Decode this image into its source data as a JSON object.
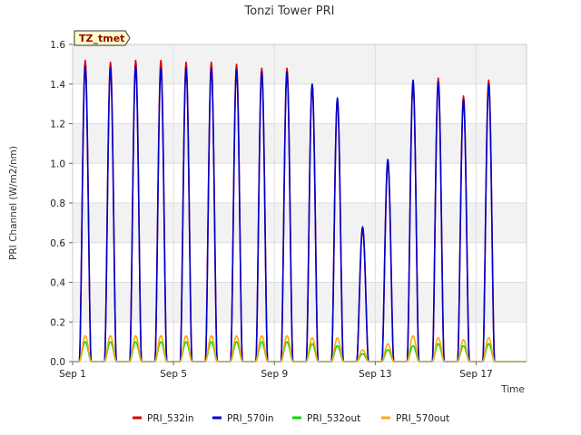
{
  "chart_data": {
    "type": "line",
    "title": "Tonzi Tower PRI",
    "xlabel": "Time",
    "ylabel": "PRI Channel (W/m2/nm)",
    "tag": "TZ_tmet",
    "xlim": [
      "2024-09-01",
      "2024-09-19"
    ],
    "ylim": [
      0,
      1.6
    ],
    "y_ticks": [
      0.0,
      0.2,
      0.4,
      0.6,
      0.8,
      1.0,
      1.2,
      1.4,
      1.6
    ],
    "x_ticks": [
      {
        "date": "2024-09-01",
        "label": "Sep 1"
      },
      {
        "date": "2024-09-05",
        "label": "Sep 5"
      },
      {
        "date": "2024-09-09",
        "label": "Sep 9"
      },
      {
        "date": "2024-09-13",
        "label": "Sep 13"
      },
      {
        "date": "2024-09-17",
        "label": "Sep 17"
      }
    ],
    "grid": true,
    "legend_position": "bottom",
    "days": [
      "2024-09-01",
      "2024-09-02",
      "2024-09-03",
      "2024-09-04",
      "2024-09-05",
      "2024-09-06",
      "2024-09-07",
      "2024-09-08",
      "2024-09-09",
      "2024-09-10",
      "2024-09-11",
      "2024-09-12",
      "2024-09-13",
      "2024-09-14",
      "2024-09-15",
      "2024-09-16",
      "2024-09-17",
      "2024-09-18"
    ],
    "series": [
      {
        "name": "PRI_532in",
        "color": "#dd0000",
        "daily_peak": [
          1.52,
          1.51,
          1.52,
          1.52,
          1.51,
          1.51,
          1.5,
          1.48,
          1.48,
          1.4,
          1.32,
          0.67,
          1.0,
          1.4,
          1.43,
          1.34,
          1.42,
          0
        ]
      },
      {
        "name": "PRI_570in",
        "color": "#0000cc",
        "daily_peak": [
          1.49,
          1.48,
          1.49,
          1.48,
          1.48,
          1.48,
          1.47,
          1.46,
          1.46,
          1.4,
          1.33,
          0.68,
          1.02,
          1.42,
          1.41,
          1.32,
          1.4,
          0
        ]
      },
      {
        "name": "PRI_532out",
        "color": "#00dd00",
        "daily_peak": [
          0.1,
          0.1,
          0.1,
          0.1,
          0.1,
          0.1,
          0.1,
          0.1,
          0.1,
          0.09,
          0.08,
          0.04,
          0.06,
          0.08,
          0.09,
          0.08,
          0.09,
          0
        ]
      },
      {
        "name": "PRI_570out",
        "color": "#ffaa00",
        "daily_peak": [
          0.13,
          0.13,
          0.13,
          0.13,
          0.13,
          0.13,
          0.13,
          0.13,
          0.13,
          0.12,
          0.12,
          0.06,
          0.09,
          0.13,
          0.12,
          0.11,
          0.12,
          0
        ]
      }
    ]
  }
}
